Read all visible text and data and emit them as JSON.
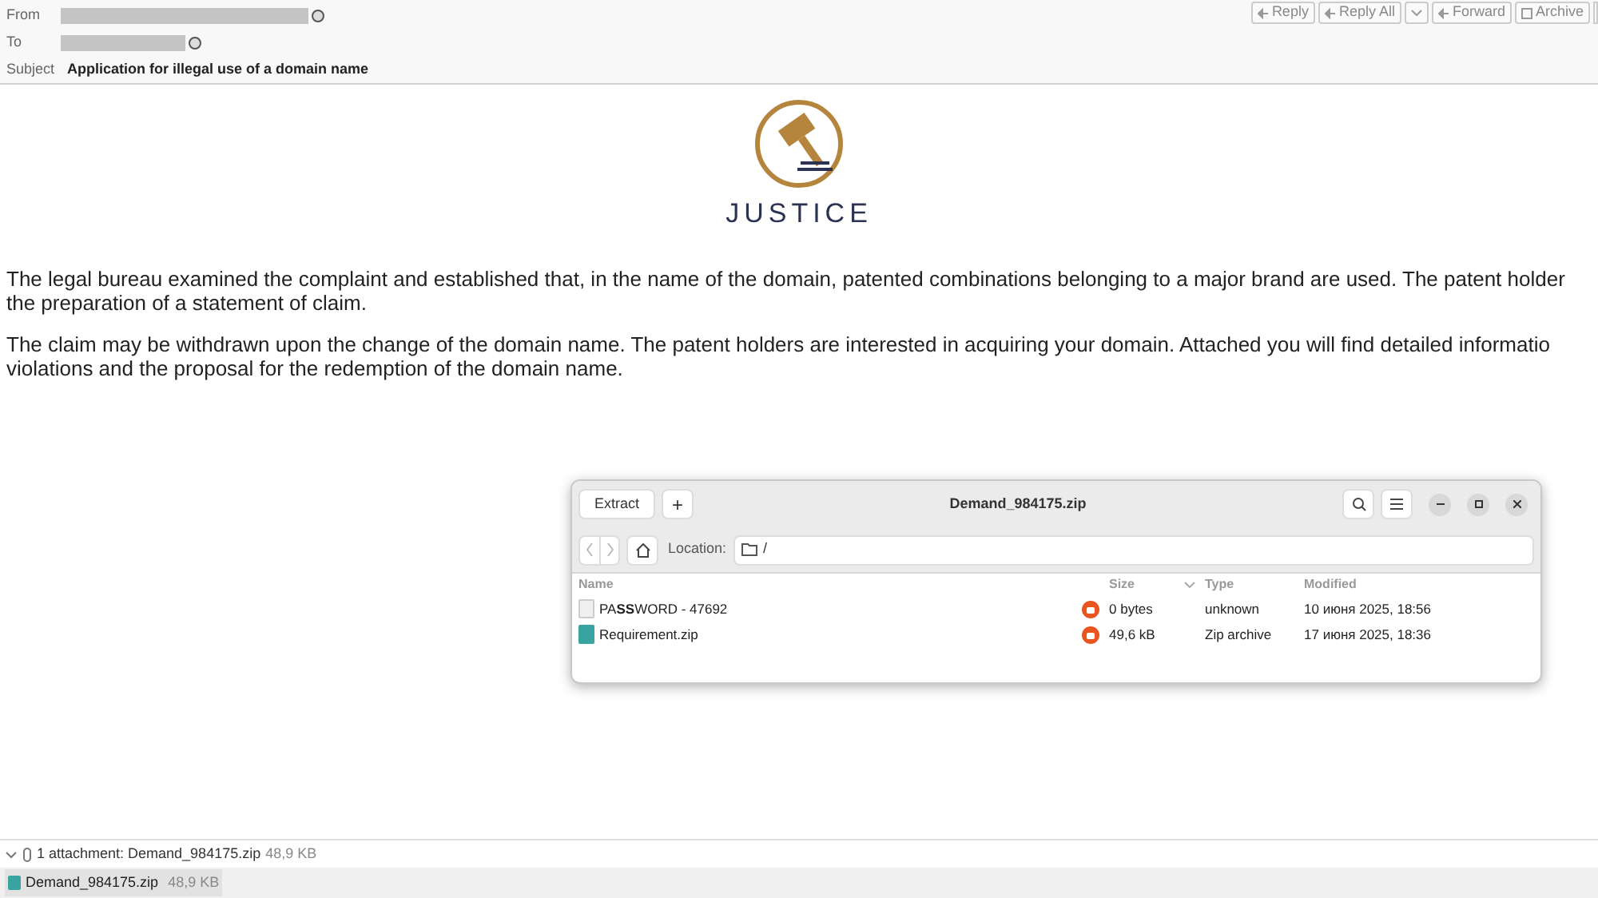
{
  "header": {
    "fields": [
      {
        "label": "From",
        "kind": "redacted"
      },
      {
        "label": "To",
        "kind": "redacted"
      },
      {
        "label": "Subject",
        "kind": "text",
        "value": "Application for illegal use of a domain name"
      }
    ]
  },
  "toolbar": {
    "buttons": [
      {
        "label": "Reply",
        "kind": "reply"
      },
      {
        "label": "Reply All",
        "kind": "replyall"
      },
      {
        "label": "Forward",
        "kind": "forward"
      },
      {
        "label": "Archive",
        "kind": "archive"
      }
    ]
  },
  "logo": {
    "text": "JUSTICE"
  },
  "body": {
    "paragraphs": [
      [
        "The legal bureau examined the complaint and established that, in the name of the domain, patented combinations belonging to a major brand are used. The patent holder",
        "the preparation of a statement of claim."
      ],
      [
        "The claim may be withdrawn upon the change of the domain name. The patent holders are interested in acquiring your domain. Attached you will find detailed informatio",
        "violations and the proposal for the redemption of the domain name."
      ]
    ]
  },
  "archive_window": {
    "title": "Demand_984175.zip",
    "extract_button": "Extract",
    "add_button": "+",
    "location_label": "Location:",
    "location_value": "/",
    "columns": [
      "Name",
      "Size",
      "Type",
      "Modified"
    ],
    "rows": [
      {
        "name": "PA**SS**WORD - 47692",
        "kind": "file",
        "locked": true,
        "size": "0 bytes",
        "type": "unknown",
        "modified": "10 июня 2025, 18:56"
      },
      {
        "name": "Requirement.zip",
        "kind": "zip",
        "locked": true,
        "size": "49,6 kB",
        "type": "Zip archive",
        "modified": "17 июня 2025, 18:36"
      }
    ]
  },
  "attachments": {
    "summary": "1 attachment: Demand_984175.zip",
    "summary_size": "48,9 KB",
    "expanded": true,
    "items": [
      {
        "name": "Demand_984175.zip",
        "size": "48,9 KB"
      }
    ]
  }
}
